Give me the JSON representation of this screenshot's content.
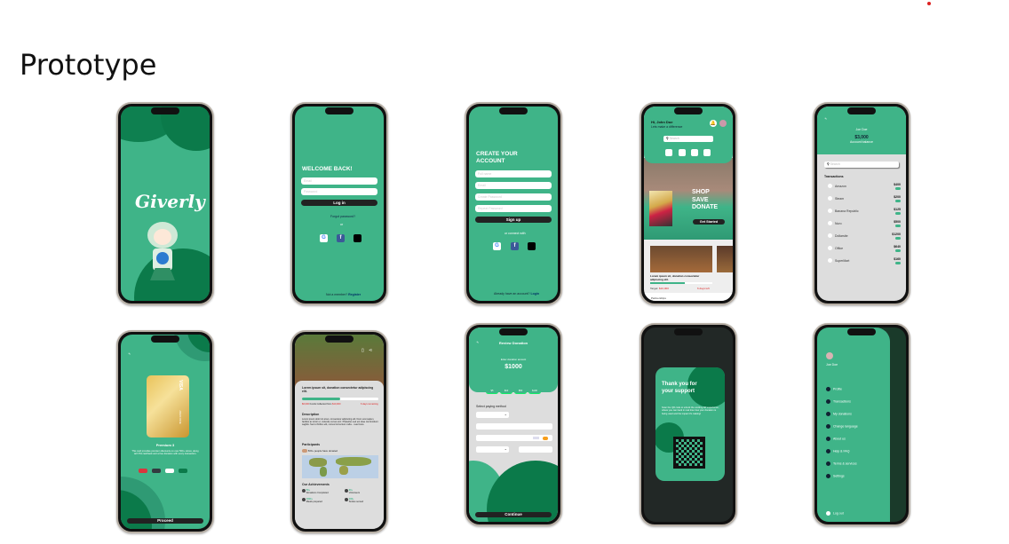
{
  "slide": {
    "title": "Prototype"
  },
  "splash": {
    "logo": "Giverly"
  },
  "login": {
    "title": "WELCOME BACK!",
    "email_ph": "Email",
    "password_ph": "Password",
    "login": "Log in",
    "forgot": "Forgot password?",
    "or": "or",
    "footer": "Not a member?",
    "register": "Register"
  },
  "signup": {
    "title": "CREATE YOUR ACCOUNT",
    "fields": [
      "Full name",
      "Email",
      "Create Password",
      "Repeat Password"
    ],
    "button": "Sign up",
    "connect": "or connect with",
    "footer": "Already have an account?",
    "login": "Login"
  },
  "social": {
    "google": "G",
    "facebook": "f",
    "apple": ""
  },
  "home": {
    "greeting": "Hi, John Doe",
    "sub": "Lets make a difference",
    "search_ph": "Search",
    "banner": [
      "SHOP",
      "SAVE",
      "DONATE"
    ],
    "cta": "Get Started",
    "card_title": "Lorem ipsum sit, donation consectetur adipiscing elit.",
    "target_label": "Target:",
    "target": "$10,000",
    "days": "6 days left",
    "partnerships": "Partnerships"
  },
  "transactions": {
    "name": "Joe Doe",
    "balance": "$3,000",
    "balance_label": "Account balance",
    "search_ph": "Search",
    "heading": "Transactions",
    "items": [
      {
        "name": "Amazon",
        "amount": "$400"
      },
      {
        "name": "Steam",
        "amount": "$200"
      },
      {
        "name": "Banana Republic",
        "amount": "$125"
      },
      {
        "name": "Nuro",
        "amount": "$500"
      },
      {
        "name": "Dollarsite",
        "amount": "$1200"
      },
      {
        "name": "Office",
        "amount": "$640"
      },
      {
        "name": "SuperMart",
        "amount": "$160"
      }
    ]
  },
  "card": {
    "brand": "VISA",
    "holder": "JOHN DOE",
    "plan": "Premium 3",
    "desc": "This card provides premium discounts on over 500+ stores, along with 5% cashback and a free donation with every transaction.",
    "swatches": [
      "#d9363e",
      "#333a40",
      "#ffffff",
      "#0b7a4a"
    ],
    "proceed": "Proceed"
  },
  "detail": {
    "title": "Lorem ipsum sit, donation consectetur adipiscing elit.",
    "progress": 0.5,
    "collected": "$6,000",
    "collected_text": "Funds Collected from",
    "goal": "$10,000",
    "days": "6 days remaining",
    "desc_h": "Description",
    "desc": "Lorem ipsum dolor sit amet, consectetur adipiscing elit. Nunc erat sapien, facilisis ac tortor ut, molestie cursus orci. Phasellus sed est vitae nisi tincidunt sagittis. Sed ut finibus elit, cursus fermentum nulla... read more",
    "participants_h": "Participants",
    "participants": "500+ people have donated",
    "ach_h": "Our Achievements",
    "ach": [
      {
        "v": "50+",
        "l": "Donations Completed"
      },
      {
        "v": "20+",
        "l": "Volunteers"
      },
      {
        "v": "1000+",
        "l": "Meals prepared"
      },
      {
        "v": "100+",
        "l": "Smiles served"
      }
    ]
  },
  "review": {
    "title": "Review Donation",
    "amount_label": "Enter donation amount",
    "amount": "$1000",
    "chips": [
      "$5",
      "$10",
      "$50",
      "$100"
    ],
    "method": "Select paying method",
    "continue": "Continue"
  },
  "thanks": {
    "title": "Thank you for your support",
    "text": "Scan the QR code to unlock the exciting AR experience, where you can track in real time how your donation is being used and the impact it's making!"
  },
  "menu": {
    "name": "Joe Doe",
    "items": [
      "Profile",
      "Transactions",
      "My donations",
      "Change language",
      "About us",
      "Help & FAQ",
      "Terms & services",
      "Settings"
    ],
    "logout": "Log out"
  }
}
